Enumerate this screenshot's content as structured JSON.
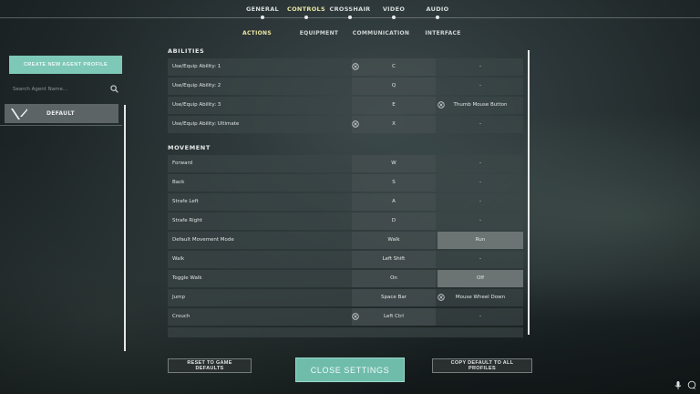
{
  "nav": {
    "tabs": [
      {
        "label": "GENERAL",
        "active": false
      },
      {
        "label": "CONTROLS",
        "active": true
      },
      {
        "label": "CROSSHAIR",
        "active": false
      },
      {
        "label": "VIDEO",
        "active": false
      },
      {
        "label": "AUDIO",
        "active": false
      }
    ],
    "subtabs": [
      {
        "label": "ACTIONS",
        "active": true
      },
      {
        "label": "EQUIPMENT",
        "active": false
      },
      {
        "label": "COMMUNICATION",
        "active": false
      },
      {
        "label": "INTERFACE",
        "active": false
      }
    ]
  },
  "sidebar": {
    "create_label": "CREATE NEW AGENT PROFILE",
    "search_placeholder": "Search Agent Name...",
    "profiles": [
      {
        "label": "DEFAULT"
      }
    ]
  },
  "abilities": {
    "title": "ABILITIES",
    "rows": [
      {
        "action": "Use/Equip Ability: 1",
        "key1": "C",
        "key2": "-"
      },
      {
        "action": "Use/Equip Ability: 2",
        "key1": "Q",
        "key2": "-"
      },
      {
        "action": "Use/Equip Ability: 3",
        "key1": "E",
        "key2": "Thumb Mouse Button"
      },
      {
        "action": "Use/Equip Ability: Ultimate",
        "key1": "X",
        "key2": "-"
      }
    ]
  },
  "movement": {
    "title": "MOVEMENT",
    "rows": [
      {
        "action": "Forward",
        "key1": "W",
        "key2": "-"
      },
      {
        "action": "Back",
        "key1": "S",
        "key2": "-"
      },
      {
        "action": "Strafe Left",
        "key1": "A",
        "key2": "-"
      },
      {
        "action": "Strafe Right",
        "key1": "D",
        "key2": "-"
      },
      {
        "action": "Default Movement Mode",
        "key1": "Walk",
        "key2": "Run"
      },
      {
        "action": "Walk",
        "key1": "Left Shift",
        "key2": "-"
      },
      {
        "action": "Toggle Walk",
        "key1": "On",
        "key2": "Off"
      },
      {
        "action": "Jump",
        "key1": "Space Bar",
        "key2": "Mouse Wheel Down"
      },
      {
        "action": "Crouch",
        "key1": "Left Ctrl",
        "key2": "-"
      }
    ]
  },
  "footer": {
    "reset_label": "RESET TO GAME DEFAULTS",
    "close_label": "CLOSE SETTINGS",
    "copy_label": "COPY DEFAULT TO ALL PROFILES"
  },
  "colors": {
    "accent": "#7ec8b8",
    "active_tab": "#e9e6a2",
    "selected_cell": "#6b7373"
  }
}
